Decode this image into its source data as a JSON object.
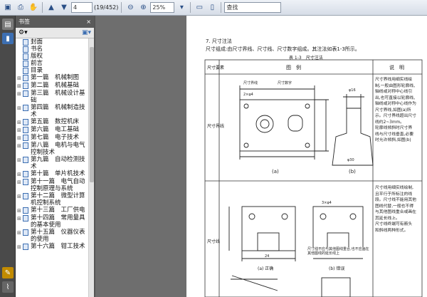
{
  "toolbar": {
    "page_current": "4",
    "page_total": "(19/452)",
    "zoom": "25%",
    "search": "查找"
  },
  "panel": {
    "title": "书签",
    "close": "×",
    "items": [
      {
        "label": "封面",
        "expandable": false
      },
      {
        "label": "书名",
        "expandable": false
      },
      {
        "label": "版权",
        "expandable": false
      },
      {
        "label": "前言",
        "expandable": false
      },
      {
        "label": "目录",
        "expandable": false
      },
      {
        "label": "第一篇　机械制图",
        "expandable": true
      },
      {
        "label": "第二篇　机械基础",
        "expandable": true
      },
      {
        "label": "第三篇　机械设计基础",
        "expandable": true
      },
      {
        "label": "第四篇　机械制造技术",
        "expandable": true
      },
      {
        "label": "第五篇　数控机床",
        "expandable": true
      },
      {
        "label": "第六篇　电工基础",
        "expandable": true
      },
      {
        "label": "第七篇　电子技术",
        "expandable": true
      },
      {
        "label": "第八篇　电机与电气控制技术",
        "expandable": true
      },
      {
        "label": "第九篇　自动检测技术",
        "expandable": true
      },
      {
        "label": "第十篇　单片机技术",
        "expandable": true
      },
      {
        "label": "第十一篇　电气自动控制原理与系统",
        "expandable": true
      },
      {
        "label": "第十二篇　微型计算机控制系统",
        "expandable": true
      },
      {
        "label": "第十三篇　工厂供电",
        "expandable": true
      },
      {
        "label": "第十四篇　常用量具的基本使用",
        "expandable": true
      },
      {
        "label": "第十五篇　仪器仪表的使用",
        "expandable": true
      },
      {
        "label": "第十六篇　钳工技术",
        "expandable": true
      }
    ]
  },
  "document": {
    "section": "7. 尺寸注法",
    "intro": "尺寸组成:由尺寸界线、尺寸线、尺寸数字组成。其注法如表1-3所示。",
    "table_caption": "表 1-3　尺寸注法",
    "col_headers": [
      "尺寸要素",
      "图　例",
      "说　明"
    ],
    "row1_label": "尺寸界线",
    "row2_label": "尺寸线",
    "fig_labels": [
      "(a)",
      "(b)",
      "(a) 正确",
      "(b) 错误"
    ],
    "callouts": [
      "尺寸界线",
      "尺寸数字",
      "2×φ4",
      "φ16",
      "φ30",
      "24",
      "3×φ4"
    ],
    "desc1": [
      "尺寸界线用细实线绘",
      "制,一般由图形轮廓线、",
      "轴线或对称中心线引",
      "出,也可直接以轮廓线、",
      "轴线或对称中心线作为",
      "尺寸界线,如图(a)所",
      "示。尺寸界线超出尺寸",
      "线约2~3mm。",
      "轮廓线倾斜时尺寸界",
      "线与尺寸线垂直,必要",
      "时允许倾斜,如图(b)"
    ],
    "desc2": [
      "尺寸线用细实线绘制,",
      "且平行于所标注的线",
      "段。尺寸线不能用其他",
      "图线代替,一般也不得",
      "与其他图线重合或画在",
      "其延长线上。",
      "尺寸线终端可有箭头",
      "和斜线两种形式。"
    ],
    "note_wrong": "尺寸线不应与其他图线重合,也不应画在其他图线的延长线上"
  }
}
